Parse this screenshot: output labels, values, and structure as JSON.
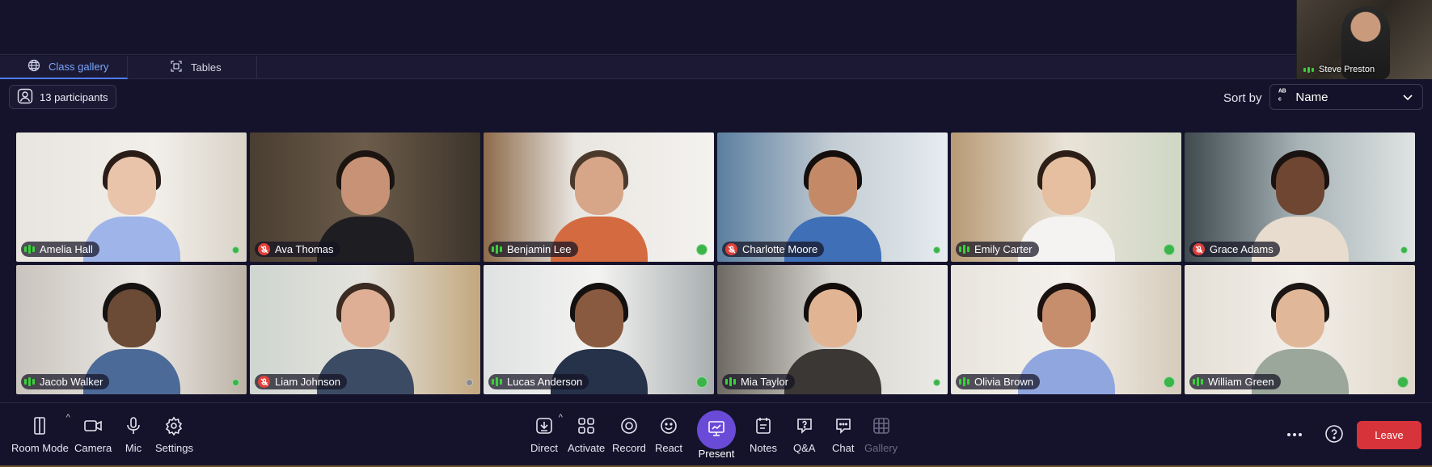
{
  "tabs": [
    {
      "label": "Class gallery",
      "icon": "globe-icon",
      "active": true
    },
    {
      "label": "Tables",
      "icon": "tables-icon",
      "active": false
    }
  ],
  "self_view": {
    "name": "Steve Preston"
  },
  "participants_chip": {
    "label": "13 participants"
  },
  "sort": {
    "label": "Sort by",
    "value": "Name",
    "icon": "alpha-sort-icon"
  },
  "participants": [
    {
      "name": "Amelia Hall",
      "muted": false
    },
    {
      "name": "Ava Thomas",
      "muted": true
    },
    {
      "name": "Benjamin Lee",
      "muted": false
    },
    {
      "name": "Charlotte Moore",
      "muted": true
    },
    {
      "name": "Emily Carter",
      "muted": false
    },
    {
      "name": "Grace Adams",
      "muted": true
    },
    {
      "name": "Jacob Walker",
      "muted": false
    },
    {
      "name": "Liam Johnson",
      "muted": true
    },
    {
      "name": "Lucas Anderson",
      "muted": false
    },
    {
      "name": "Mia Taylor",
      "muted": false
    },
    {
      "name": "Olivia Brown",
      "muted": false
    },
    {
      "name": "William Green",
      "muted": false
    }
  ],
  "toolbar": {
    "room_mode": "Room Mode",
    "camera": "Camera",
    "mic": "Mic",
    "settings": "Settings",
    "direct": "Direct",
    "activate": "Activate",
    "record": "Record",
    "react": "React",
    "present": "Present",
    "notes": "Notes",
    "qa": "Q&A",
    "chat": "Chat",
    "gallery": "Gallery",
    "leave": "Leave"
  },
  "colors": {
    "background": "#15132b",
    "accent": "#6a4bd8",
    "active_tab": "#7aa7ff",
    "leave": "#d7333b",
    "audio_active": "#3ad13a",
    "muted": "#e0403a"
  }
}
